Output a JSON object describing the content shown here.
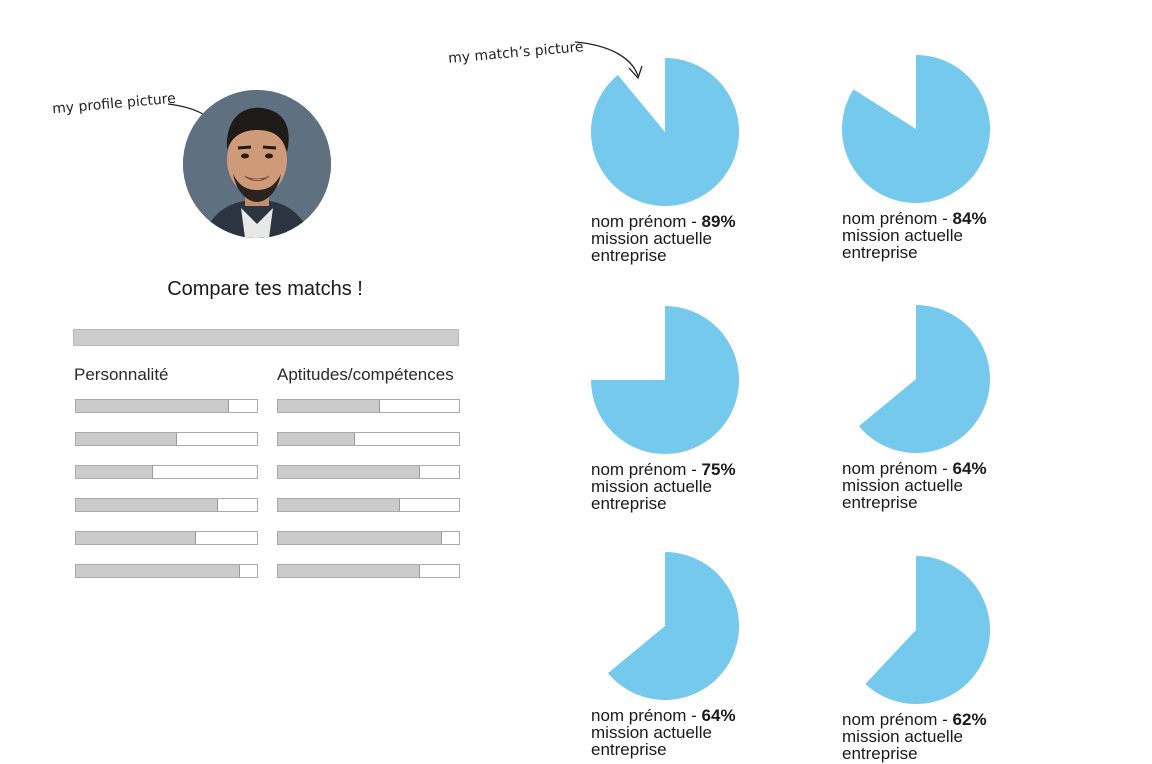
{
  "annotations": {
    "profile": "my profile picture",
    "match": "my match’s picture"
  },
  "compare": {
    "title": "Compare tes matchs !",
    "personality_heading": "Personnalité",
    "skills_heading": "Aptitudes/compétences",
    "personality_levels": [
      0.84,
      0.55,
      0.42,
      0.78,
      0.66,
      0.9
    ],
    "skills_levels": [
      0.56,
      0.42,
      0.78,
      0.67,
      0.9,
      0.78
    ]
  },
  "colors": {
    "pie": "#75c9ec",
    "bar_fill": "#cbcbcb"
  },
  "matches": [
    {
      "name": "nom prénom - ",
      "pct": "89%",
      "value": 0.89,
      "mission": "mission actuelle",
      "company": "entreprise"
    },
    {
      "name": "nom prénom - ",
      "pct": "84%",
      "value": 0.84,
      "mission": "mission actuelle",
      "company": "entreprise"
    },
    {
      "name": "nom prénom - ",
      "pct": "75%",
      "value": 0.75,
      "mission": "mission actuelle",
      "company": "entreprise"
    },
    {
      "name": "nom prénom - ",
      "pct": "64%",
      "value": 0.64,
      "mission": "mission actuelle",
      "company": "entreprise"
    },
    {
      "name": "nom prénom - ",
      "pct": "64%",
      "value": 0.64,
      "mission": "mission actuelle",
      "company": "entreprise"
    },
    {
      "name": "nom prénom - ",
      "pct": "62%",
      "value": 0.62,
      "mission": "mission actuelle",
      "company": "entreprise"
    }
  ]
}
